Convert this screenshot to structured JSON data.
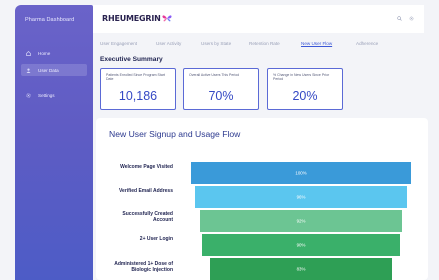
{
  "sidebar": {
    "title": "Pharma Dashboard",
    "items": [
      {
        "label": "Home",
        "icon": "home-icon"
      },
      {
        "label": "User Data",
        "icon": "user-icon",
        "active": true
      },
      {
        "label": "Settings",
        "icon": "gear-icon"
      }
    ]
  },
  "header": {
    "logo_text": "RHEUMEGRIN",
    "icons": [
      "search-icon",
      "settings-icon"
    ]
  },
  "tabs": [
    {
      "label": "User Engagement"
    },
    {
      "label": "User Activity"
    },
    {
      "label": "Users by State"
    },
    {
      "label": "Retention Rate"
    },
    {
      "label": "New User Flow",
      "active": true
    },
    {
      "label": "Adherence"
    }
  ],
  "executive_summary": {
    "title": "Executive Summary",
    "kpis": [
      {
        "label": "Patients Enrolled Since Program Start Date",
        "value": "10,186"
      },
      {
        "label": "Overall Active Users This Period",
        "value": "70%"
      },
      {
        "label": "% Change in New Users Since Prior Period",
        "value": "20%"
      }
    ]
  },
  "funnel": {
    "title": "New User Signup and Usage Flow",
    "steps": [
      {
        "label": "Welcome Page Visited",
        "percent": "100%",
        "fraction": 1.0,
        "color": "#3a9ad9"
      },
      {
        "label": "Verified Email Address",
        "percent": "96%",
        "fraction": 0.96,
        "color": "#5bc6ef"
      },
      {
        "label": "Successfully Created Account",
        "percent": "92%",
        "fraction": 0.92,
        "color": "#6cc593"
      },
      {
        "label": "2+ User Login",
        "percent": "90%",
        "fraction": 0.9,
        "color": "#3ab06a"
      },
      {
        "label": "Administered 1+ Dose of Biologic Injection",
        "percent": "83%",
        "fraction": 0.83,
        "color": "#2e9f55"
      }
    ]
  }
}
